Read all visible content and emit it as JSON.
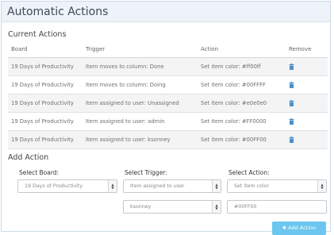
{
  "panel": {
    "title": "Automatic Actions"
  },
  "current": {
    "heading": "Current Actions",
    "columns": {
      "board": "Board",
      "trigger": "Trigger",
      "action": "Action",
      "remove": "Remove"
    },
    "rows": [
      {
        "board": "19 Days of Productivity",
        "trigger": "Item moves to column: Done",
        "action": "Set item color: #ff00ff"
      },
      {
        "board": "19 Days of Productivity",
        "trigger": "Item moves to column: Doing",
        "action": "Set item color: #00FFFF"
      },
      {
        "board": "19 Days of Productivity",
        "trigger": "Item assigned to user: Unassigned",
        "action": "Set item color: #e0e0e0"
      },
      {
        "board": "19 Days of Productivity",
        "trigger": "Item assigned to user: admin",
        "action": "Set item color: #FF0000"
      },
      {
        "board": "19 Days of Productivity",
        "trigger": "Item assigned to user: ksonney",
        "action": "Set item color: #00FF00"
      }
    ]
  },
  "add": {
    "heading": "Add Action",
    "board_label": "Select Board:",
    "trigger_label": "Select Trigger:",
    "action_label": "Select Action:",
    "board_value": "19 Days of Productivity",
    "trigger_value": "Item assigned to user",
    "action_value": "Set item color",
    "user_value": "ksonney",
    "color_value": "#00FF00",
    "button_label": "Add Action",
    "button_icon": "plus-icon"
  },
  "colors": {
    "header_bg": "#edf3f9",
    "trash_icon": "#4a90c8",
    "button_bg": "#6cc6ef"
  }
}
